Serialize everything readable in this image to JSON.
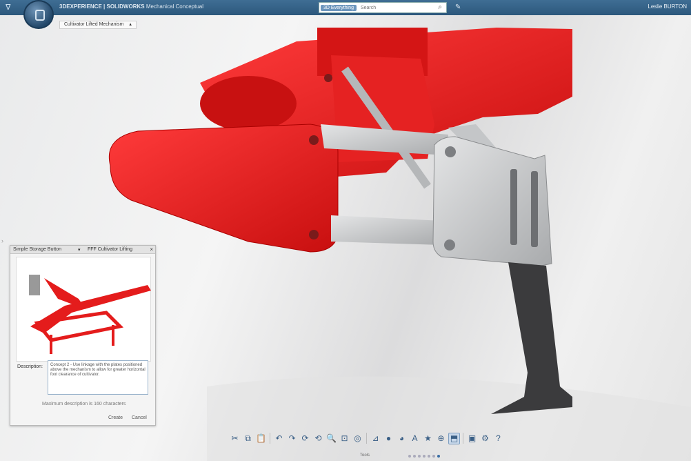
{
  "topbar": {
    "brand_icon": "3ds-logo-icon",
    "app_title_brand": "3DEXPERIENCE | SOLIDWORKS",
    "app_title_product": "Mechanical Conceptual",
    "search_tag": "3D Everything",
    "search_placeholder": "Search",
    "user_name": "Leslie BURTON"
  },
  "breadcrumb": {
    "label": "Cultivator Lifted Mechanism"
  },
  "dialog": {
    "title": "Simple Storage Button",
    "separator": "▾",
    "subtitle": "FFF Cultivator Lifting",
    "close": "×",
    "description_label": "Description:",
    "description_text": "Concept 2 - Use linkage with the plates positioned above the mechanism to allow for greater horizontal foot clearance of cultivator.",
    "hint": "Maximum description is 160 characters",
    "create_label": "Create",
    "cancel_label": "Cancel"
  },
  "toolbar": {
    "label": "Tools",
    "buttons": [
      {
        "icon": "scissors-icon",
        "glyph": "✂"
      },
      {
        "icon": "copy-icon",
        "glyph": "⧉"
      },
      {
        "icon": "paste-icon",
        "glyph": "📋"
      },
      {
        "icon": "undo-icon",
        "glyph": "↶"
      },
      {
        "icon": "redo-icon",
        "glyph": "↷"
      },
      {
        "icon": "refresh-icon",
        "glyph": "⟳"
      },
      {
        "icon": "rotate-icon",
        "glyph": "⟲"
      },
      {
        "icon": "zoom-icon",
        "glyph": "🔍"
      },
      {
        "icon": "fit-icon",
        "glyph": "⊡"
      },
      {
        "icon": "view-icon",
        "glyph": "◎"
      },
      {
        "icon": "measure-icon",
        "glyph": "⊿"
      },
      {
        "icon": "render-icon",
        "glyph": "●"
      },
      {
        "icon": "color-icon",
        "glyph": "◕"
      },
      {
        "icon": "text-icon",
        "glyph": "A"
      },
      {
        "icon": "star-icon",
        "glyph": "★"
      },
      {
        "icon": "globe-icon",
        "glyph": "⊕"
      },
      {
        "icon": "capture-icon",
        "glyph": "⬒"
      },
      {
        "icon": "image-icon",
        "glyph": "▣"
      },
      {
        "icon": "settings-icon",
        "glyph": "⚙"
      },
      {
        "icon": "help-icon",
        "glyph": "?"
      }
    ],
    "active_index": 16,
    "page_dots": 7,
    "active_dot": 6
  },
  "colors": {
    "topbar": "#2c587c",
    "part_red": "#e41c1c",
    "part_gray": "#cfd0d2",
    "tine_dark": "#3a3a3c",
    "accent": "#3a6ea5"
  }
}
